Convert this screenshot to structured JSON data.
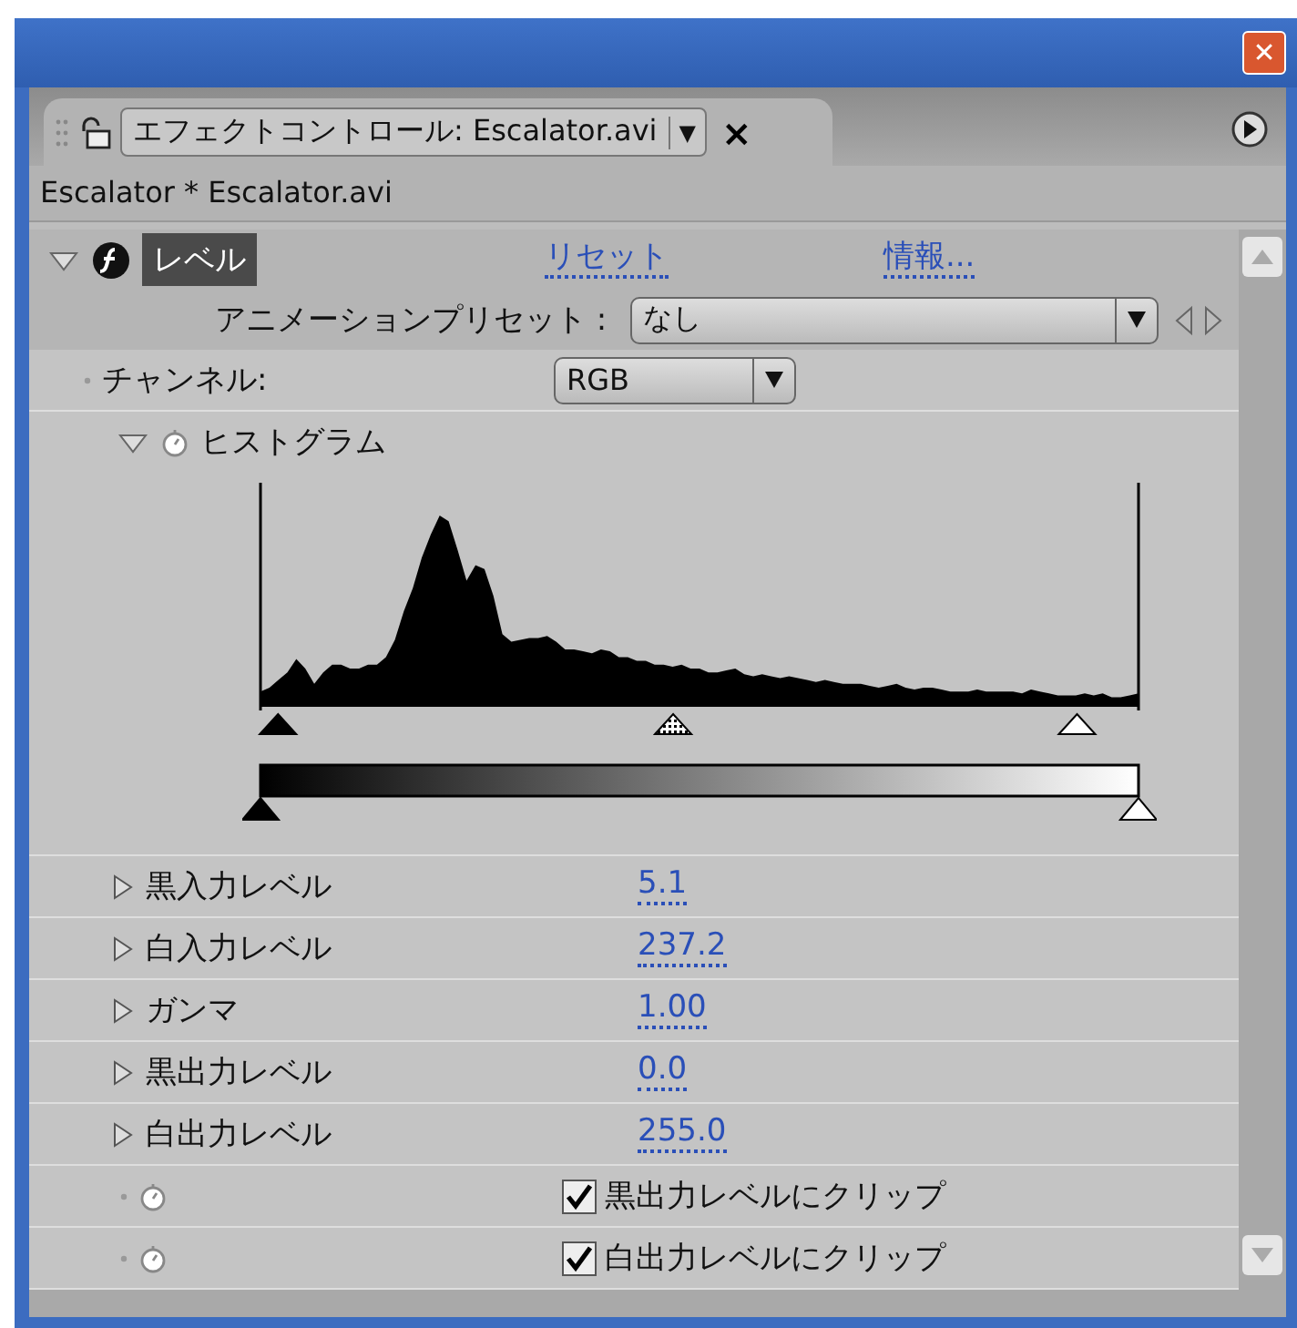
{
  "window": {
    "close_symbol": "✕"
  },
  "panel_tab": {
    "title": "エフェクトコントロール: Escalator.avi",
    "dropdown_symbol": "▼",
    "close_symbol": "×"
  },
  "breadcrumb": "Escalator * Escalator.avi",
  "effect": {
    "name": "レベル",
    "selected": true,
    "expanded": true,
    "reset_link": "リセット",
    "info_link": "情報..."
  },
  "preset": {
    "label": "アニメーションプリセット :",
    "value": "なし"
  },
  "channel": {
    "label": "チャンネル:",
    "value": "RGB"
  },
  "histogram": {
    "label": "ヒストグラム",
    "expanded": true,
    "input_markers": [
      {
        "kind": "black",
        "level": 0.02
      },
      {
        "kind": "gray",
        "level": 0.47
      },
      {
        "kind": "white",
        "level": 0.93
      }
    ],
    "output_markers": [
      {
        "kind": "black",
        "level": 0
      },
      {
        "kind": "white",
        "level": 1
      }
    ]
  },
  "params": [
    {
      "label": "黒入力レベル",
      "value": "5.1",
      "expanded": false
    },
    {
      "label": "白入力レベル",
      "value": "237.2",
      "expanded": false
    },
    {
      "label": "ガンマ",
      "value": "1.00",
      "expanded": false
    },
    {
      "label": "黒出力レベル",
      "value": "0.0",
      "expanded": false
    },
    {
      "label": "白出力レベル",
      "value": "255.0",
      "expanded": false
    }
  ],
  "clips": [
    {
      "label": "黒出力レベルにクリップ",
      "checked": true
    },
    {
      "label": "白出力レベルにクリップ",
      "checked": true
    }
  ]
}
